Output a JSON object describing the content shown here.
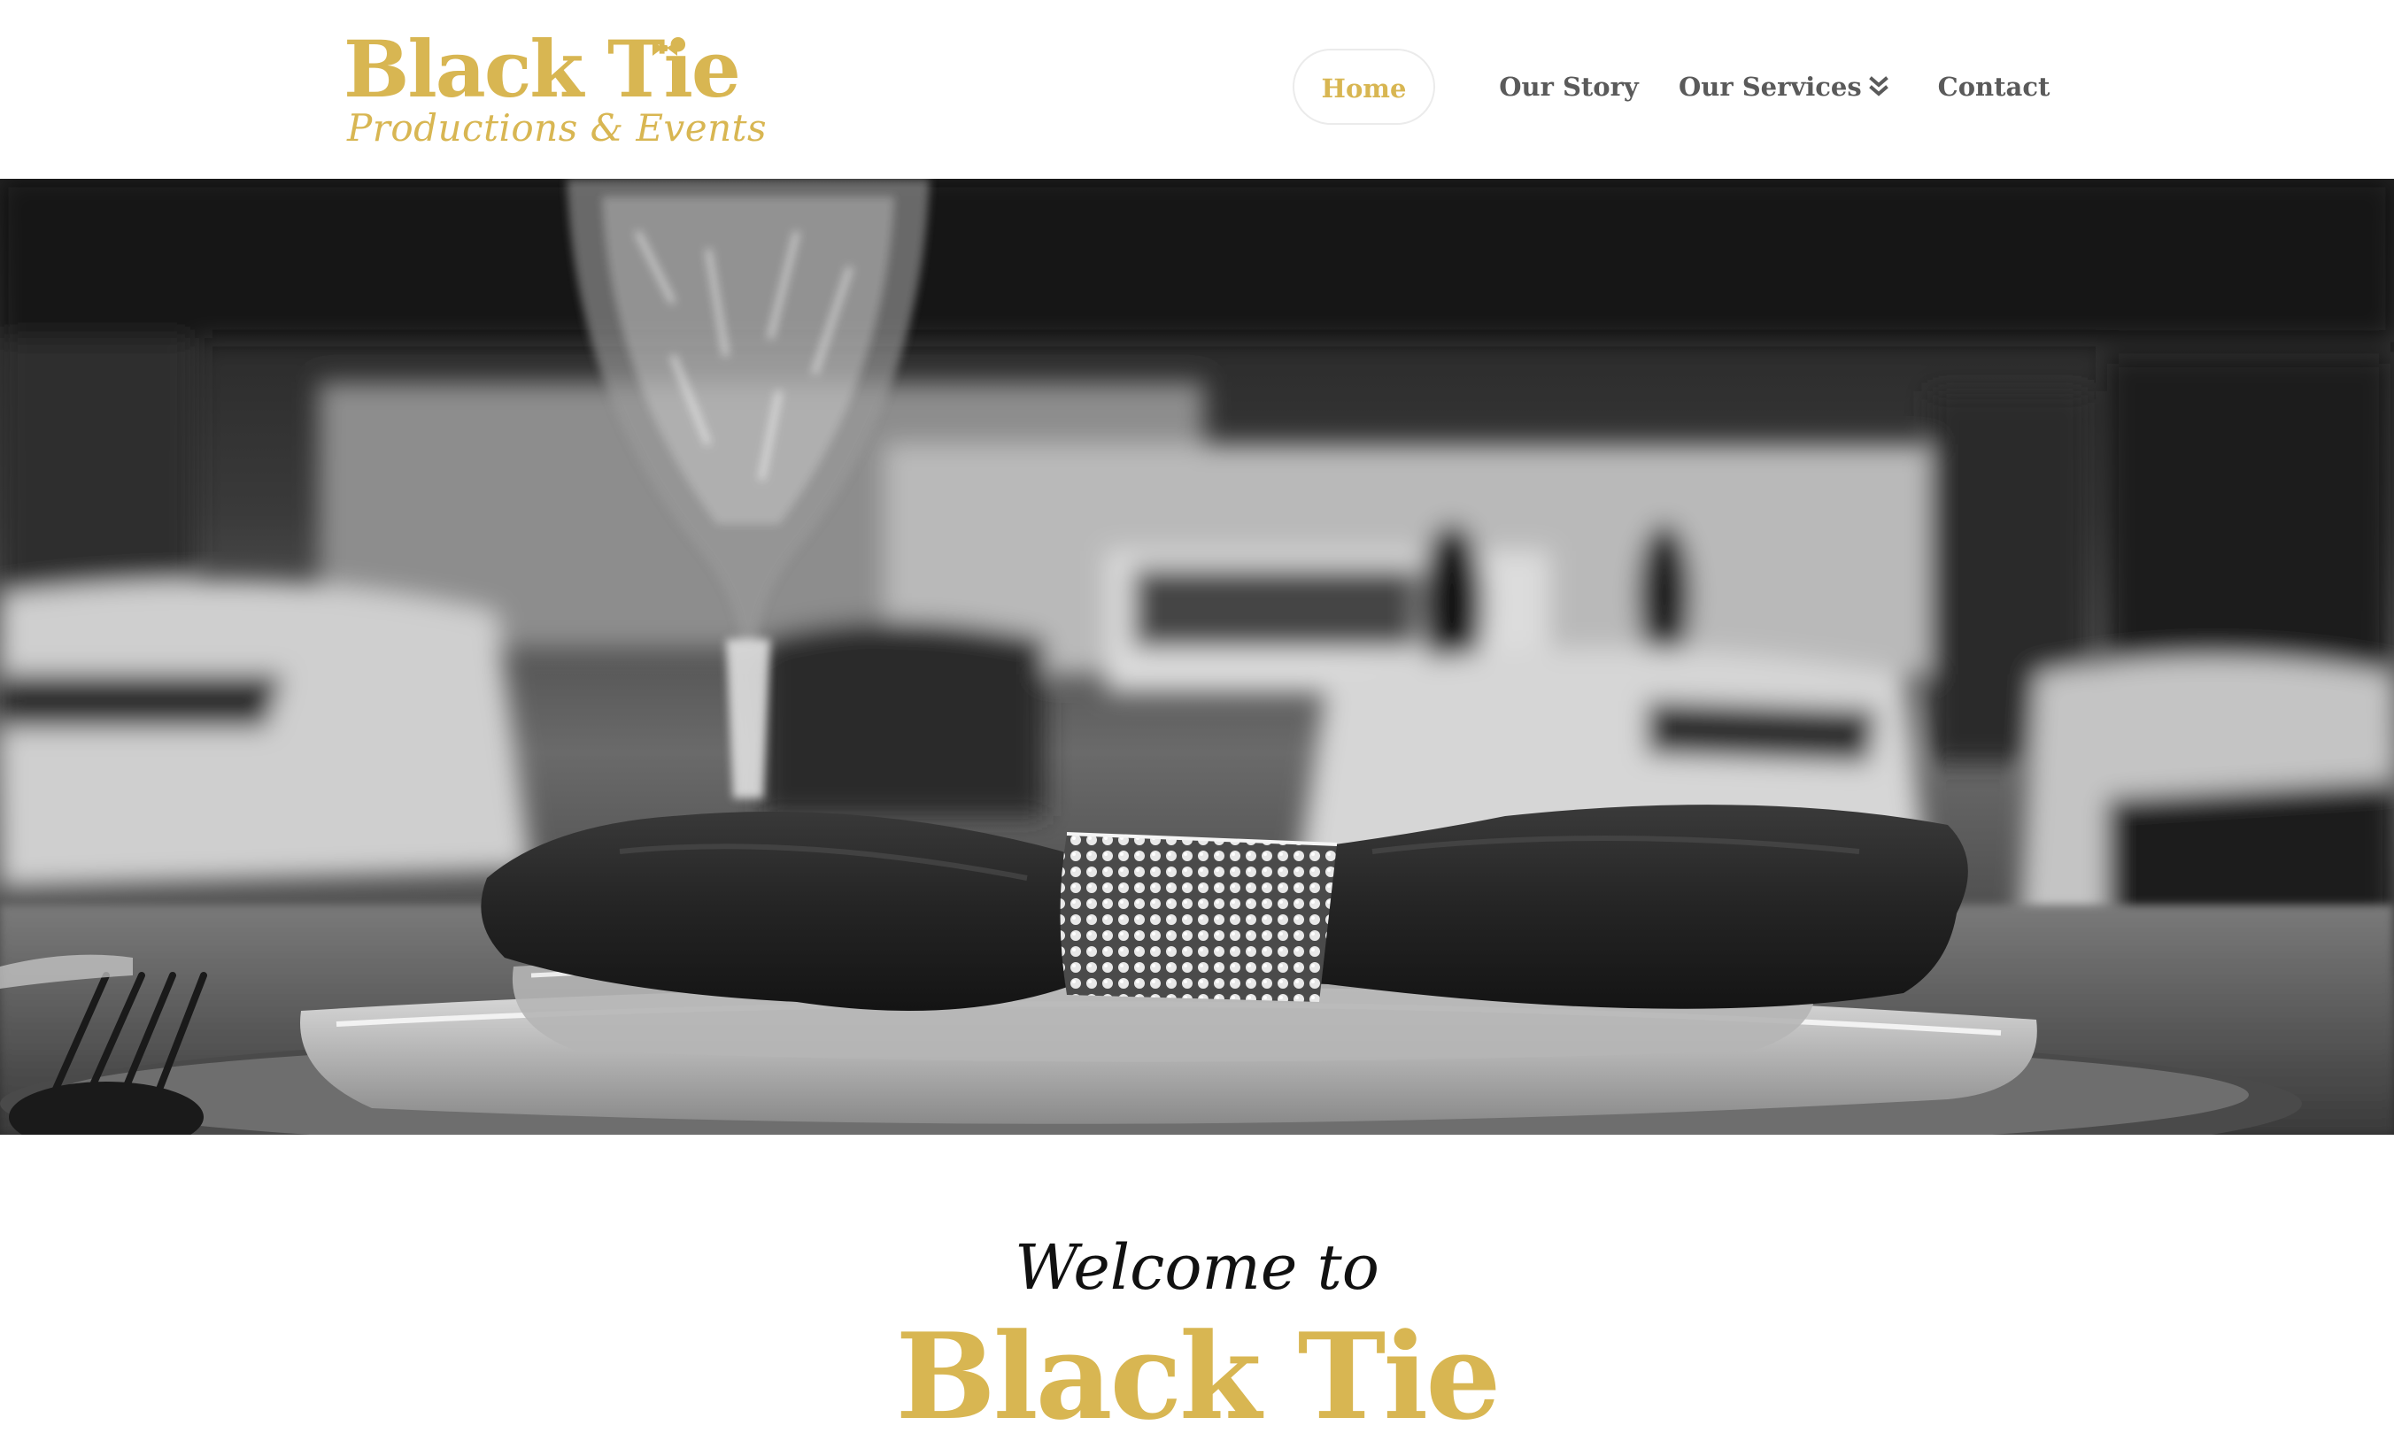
{
  "brand": {
    "name": "Black Tie",
    "tagline": "Productions & Events",
    "gold": "#d8b652",
    "dark": "#5a5a5a"
  },
  "nav": {
    "items": [
      {
        "label": "Home",
        "active": true
      },
      {
        "label": "Our Story",
        "active": false
      },
      {
        "label": "Our Services",
        "active": false,
        "has_dropdown": true,
        "icon": "double-chevron-down-icon"
      },
      {
        "label": "Contact",
        "active": false
      }
    ]
  },
  "hero": {
    "image": "black-and-white photo of place setting with napkin, rhinestone napkin ring, crystal glass and fork"
  },
  "welcome": {
    "greeting": "Welcome to",
    "brand": "Black Tie"
  }
}
